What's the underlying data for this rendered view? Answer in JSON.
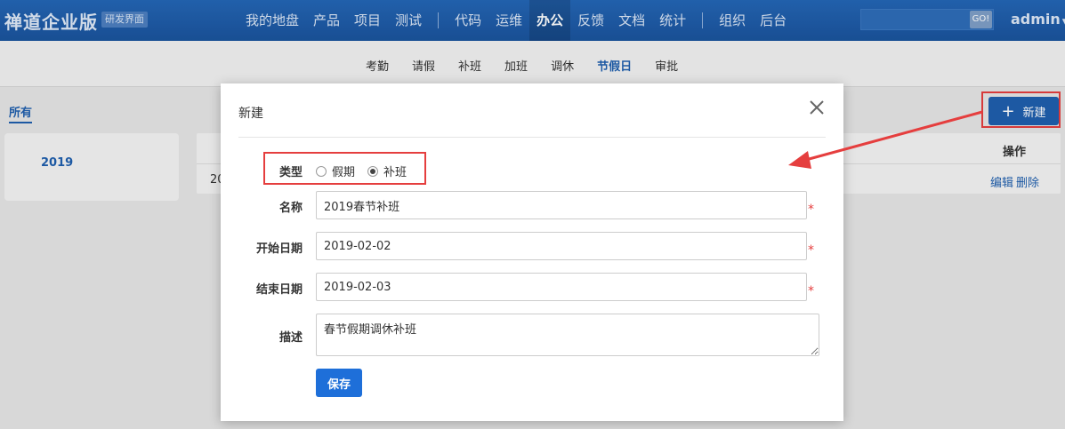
{
  "header": {
    "brand": "禅道企业版",
    "brand_tag": "研发界面",
    "nav": [
      {
        "label": "我的地盘"
      },
      {
        "label": "产品"
      },
      {
        "label": "项目"
      },
      {
        "label": "测试"
      },
      {
        "label": "代码"
      },
      {
        "label": "运维"
      },
      {
        "label": "办公"
      },
      {
        "label": "反馈"
      },
      {
        "label": "文档"
      },
      {
        "label": "统计"
      },
      {
        "label": "组织"
      },
      {
        "label": "后台"
      }
    ],
    "search_button": "GO!",
    "user": "admin"
  },
  "subnav": {
    "items": [
      {
        "label": "考勤"
      },
      {
        "label": "请假"
      },
      {
        "label": "补班"
      },
      {
        "label": "加班"
      },
      {
        "label": "调休"
      },
      {
        "label": "节假日"
      },
      {
        "label": "审批"
      }
    ]
  },
  "main": {
    "all_tab": "所有",
    "year": "2019",
    "table": {
      "op_header": "操作",
      "row_cell": "20",
      "edit": "编辑",
      "delete": "删除"
    },
    "new_button": "新建"
  },
  "modal": {
    "title": "新建",
    "type_label": "类型",
    "type_options": [
      "假期",
      "补班"
    ],
    "type_selected": "补班",
    "name_label": "名称",
    "name_value": "2019春节补班",
    "start_label": "开始日期",
    "start_value": "2019-02-02",
    "end_label": "结束日期",
    "end_value": "2019-02-03",
    "desc_label": "描述",
    "desc_value": "春节假期调休补班",
    "required_mark": "*",
    "save_button": "保存"
  },
  "colors": {
    "primary": "#1f5fae",
    "highlight": "#e53e3e",
    "save": "#1e6fd9"
  }
}
